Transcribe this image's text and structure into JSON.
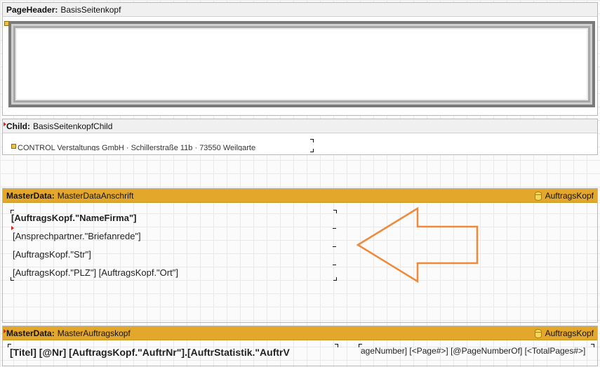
{
  "bands": {
    "page_header": {
      "kind": "PageHeader:",
      "name": "BasisSeitenkopf"
    },
    "child": {
      "kind": "Child:",
      "name": "BasisSeitenkopfChild",
      "address_text": "CONTROL Verstaltungs GmbH · Schillerstraße 11b · 73550 Weilgarten"
    },
    "master_anschrift": {
      "kind": "MasterData:",
      "name": "MasterDataAnschrift",
      "source": "AuftragsKopf",
      "fields": {
        "name_firma": "[AuftragsKopf.\"NameFirma\"]",
        "briefanrede": "[Ansprechpartner.\"Briefanrede\"]",
        "str": "[AuftragsKopf.\"Str\"]",
        "plz_ort": "[AuftragsKopf.\"PLZ\"] [AuftragsKopf.\"Ort\"]"
      }
    },
    "master_auftragskopf": {
      "kind": "MasterData:",
      "name": "MasterAuftragskopf",
      "source": "AuftragsKopf",
      "title_field": "[Titel] [@Nr] [AuftragsKopf.\"AuftrNr\"].[AuftrStatistik.\"AuftrV",
      "page_field": "ageNumber] [<Page#>] [@PageNumberOf] [<TotalPages#>]"
    }
  },
  "colors": {
    "master_header": "#e3a82b",
    "arrow": "#ef8a3c"
  }
}
